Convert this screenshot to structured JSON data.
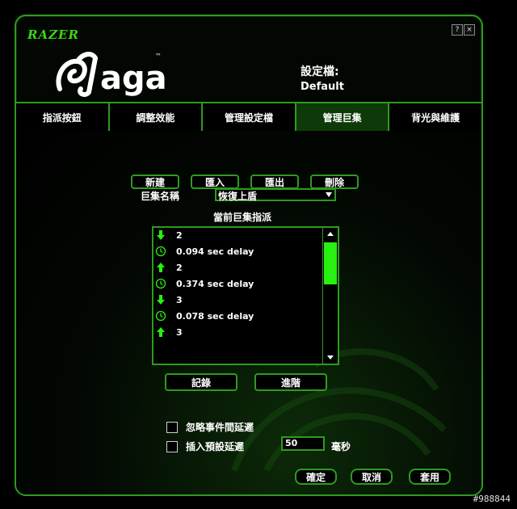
{
  "window": {
    "brand_text": "RAZER",
    "logo_text": "Naga",
    "trademark": "™",
    "help_label": "?",
    "close_label": "×"
  },
  "profile": {
    "label": "設定檔:",
    "value": "Default"
  },
  "tabs": [
    {
      "label": "指派按鈕",
      "active": false
    },
    {
      "label": "調整效能",
      "active": false
    },
    {
      "label": "管理設定檔",
      "active": false
    },
    {
      "label": "管理巨集",
      "active": true
    },
    {
      "label": "背光與維護",
      "active": false
    }
  ],
  "toolbar": {
    "new_label": "新建",
    "import_label": "匯入",
    "export_label": "匯出",
    "delete_label": "刪除"
  },
  "macro_name": {
    "label": "巨集名稱",
    "value": "恢復上盾"
  },
  "macro_list": {
    "title": "當前巨集指派",
    "items": [
      {
        "icon": "key-down-arrow-icon",
        "text": "2"
      },
      {
        "icon": "clock-icon",
        "text": "0.094 sec delay"
      },
      {
        "icon": "key-up-arrow-icon",
        "text": "2"
      },
      {
        "icon": "clock-icon",
        "text": "0.374 sec delay"
      },
      {
        "icon": "key-down-arrow-icon",
        "text": "3"
      },
      {
        "icon": "clock-icon",
        "text": "0.078 sec delay"
      },
      {
        "icon": "key-up-arrow-icon",
        "text": "3"
      }
    ]
  },
  "actions": {
    "record_label": "記錄",
    "advanced_label": "進階"
  },
  "options": {
    "ignore_delay_label": "忽略事件間延遲",
    "ignore_delay_checked": false,
    "insert_delay_label": "插入預設延遲",
    "insert_delay_checked": false,
    "delay_value": "50",
    "delay_unit": "毫秒"
  },
  "footer": {
    "ok_label": "確定",
    "cancel_label": "取消",
    "apply_label": "套用"
  },
  "watermark": "#988844",
  "colors": {
    "accent": "#2e9b1f",
    "accent_bright": "#28f010",
    "background": "#000000"
  }
}
